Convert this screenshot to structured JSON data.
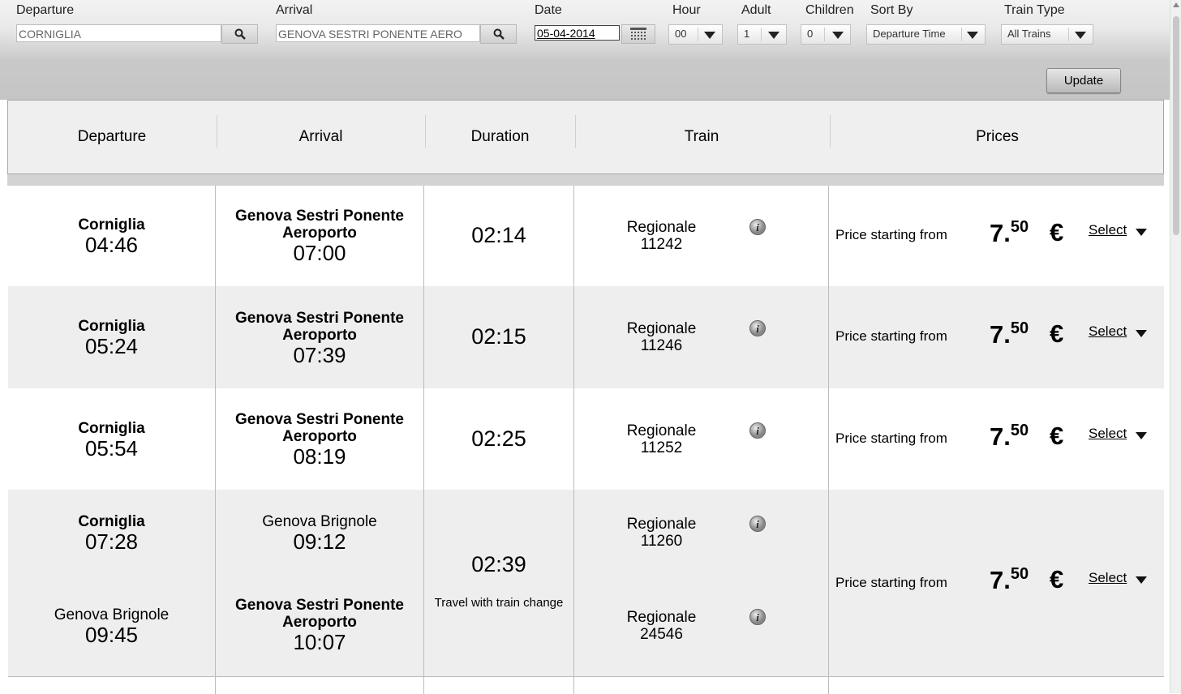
{
  "search": {
    "departure_label": "Departure",
    "departure_value": "CORNIGLIA",
    "arrival_label": "Arrival",
    "arrival_value": "GENOVA SESTRI PONENTE AERO",
    "date_label": "Date",
    "date_value": "05-04-2014",
    "hour_label": "Hour",
    "hour_value": "00",
    "adult_label": "Adult",
    "adult_value": "1",
    "children_label": "Children",
    "children_value": "0",
    "sortby_label": "Sort By",
    "sortby_value": "Departure Time",
    "traintype_label": "Train Type",
    "traintype_value": "All Trains",
    "update_label": "Update"
  },
  "columns": {
    "departure": "Departure",
    "arrival": "Arrival",
    "duration": "Duration",
    "train": "Train",
    "prices": "Prices"
  },
  "results": [
    {
      "dep_station": "Corniglia",
      "dep_time": "04:46",
      "arr_station_1": "Genova Sestri Ponente",
      "arr_station_2": "Aeroporto",
      "arr_time": "07:00",
      "duration": "02:14",
      "train_name": "Regionale",
      "train_number": "11242",
      "price_label": "Price starting from",
      "price_int": "7.",
      "price_dec": "50",
      "currency": "€",
      "select_label": "Select"
    },
    {
      "dep_station": "Corniglia",
      "dep_time": "05:24",
      "arr_station_1": "Genova Sestri Ponente",
      "arr_station_2": "Aeroporto",
      "arr_time": "07:39",
      "duration": "02:15",
      "train_name": "Regionale",
      "train_number": "11246",
      "price_label": "Price starting from",
      "price_int": "7.",
      "price_dec": "50",
      "currency": "€",
      "select_label": "Select"
    },
    {
      "dep_station": "Corniglia",
      "dep_time": "05:54",
      "arr_station_1": "Genova Sestri Ponente",
      "arr_station_2": "Aeroporto",
      "arr_time": "08:19",
      "duration": "02:25",
      "train_name": "Regionale",
      "train_number": "11252",
      "price_label": "Price starting from",
      "price_int": "7.",
      "price_dec": "50",
      "currency": "€",
      "select_label": "Select"
    }
  ],
  "change_result": {
    "leg1": {
      "dep_station": "Corniglia",
      "dep_time": "07:28",
      "arr_station": "Genova Brignole",
      "arr_time": "09:12",
      "train_name": "Regionale",
      "train_number": "11260"
    },
    "leg2": {
      "dep_station": "Genova Brignole",
      "dep_time": "09:45",
      "arr_station_1": "Genova Sestri Ponente",
      "arr_station_2": "Aeroporto",
      "arr_time": "10:07",
      "train_name": "Regionale",
      "train_number": "24546"
    },
    "duration": "02:39",
    "note": "Travel with train change",
    "price_label": "Price starting from",
    "price_int": "7.",
    "price_dec": "50",
    "currency": "€",
    "select_label": "Select"
  },
  "colors": {
    "row_alt": "#eeeeee",
    "row_white": "#ffffff",
    "header_bg": "#efefef",
    "update_button": "#c9c9c9"
  },
  "icons": [
    "search-icon",
    "calendar-icon",
    "chevron-down-icon",
    "info-icon"
  ]
}
